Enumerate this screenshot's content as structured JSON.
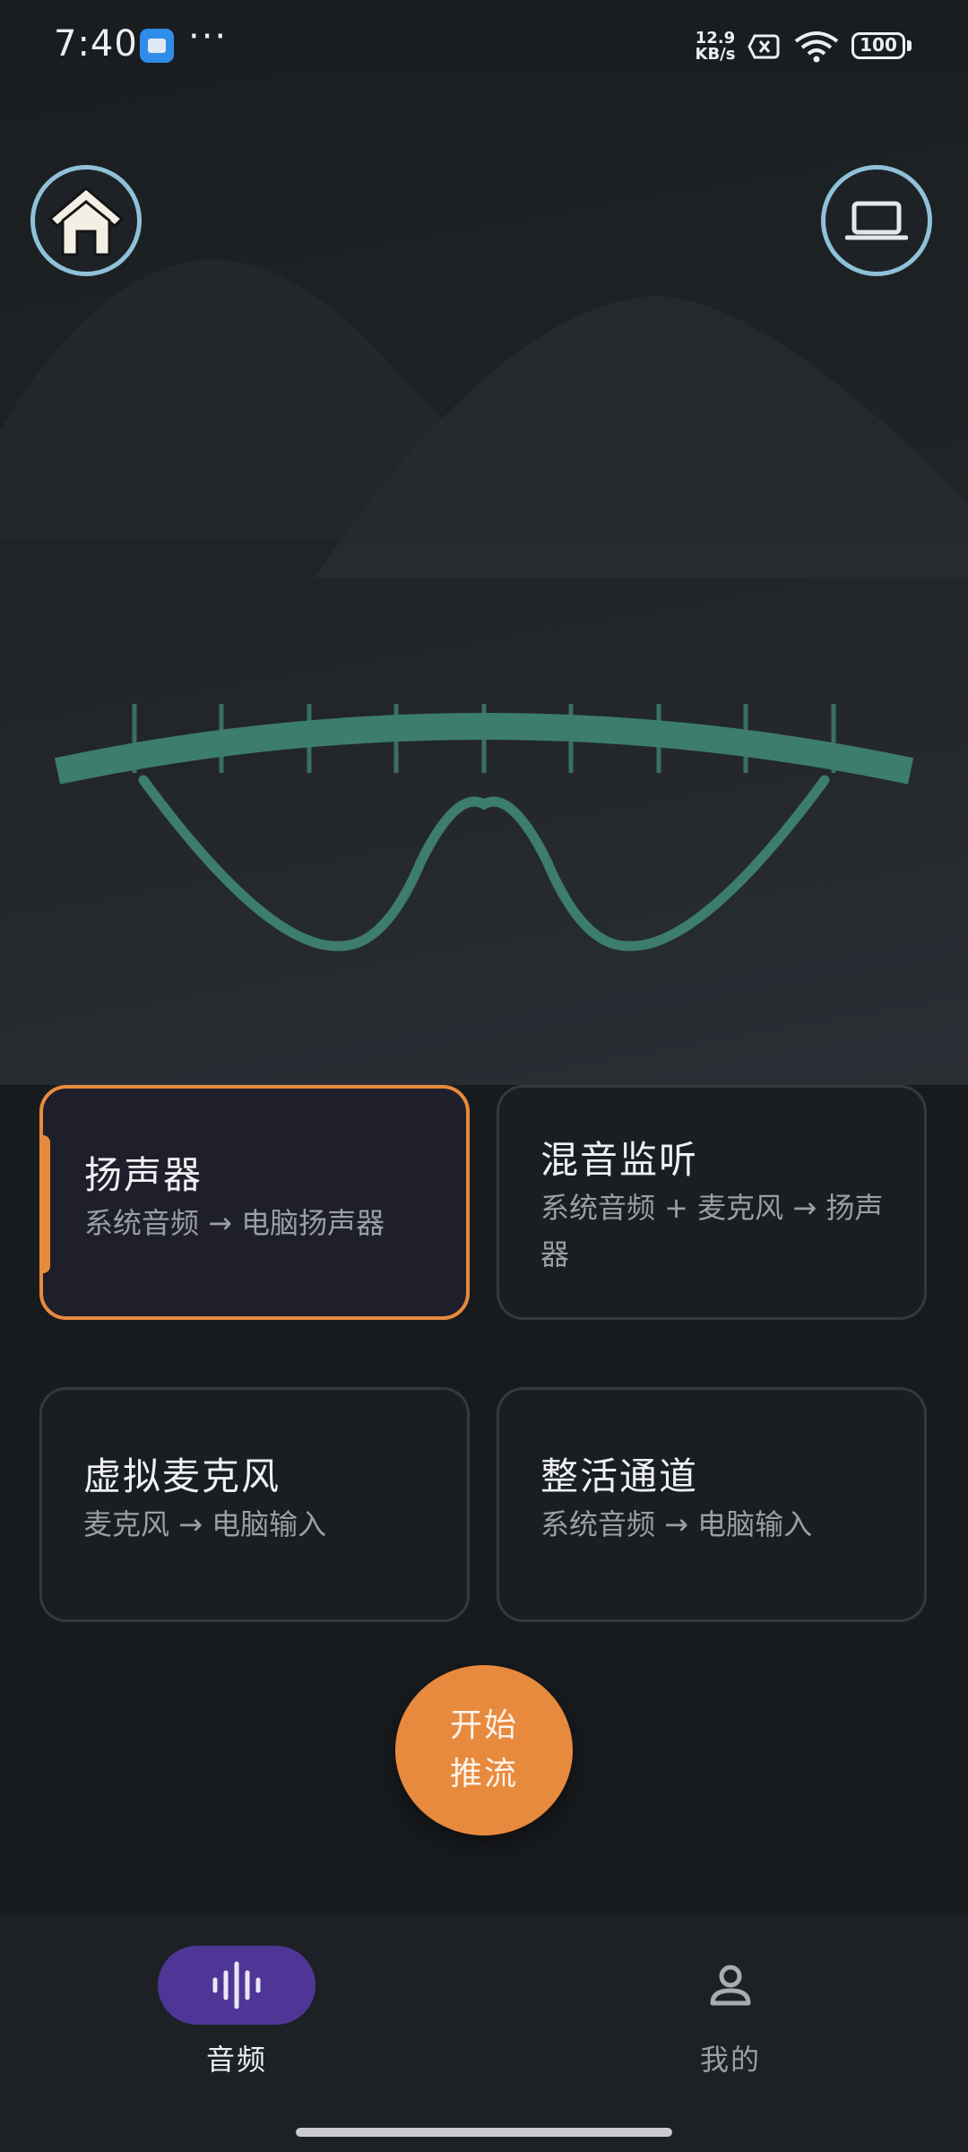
{
  "status_bar": {
    "time": "7:40",
    "more": "···",
    "net_speed_value": "12.9",
    "net_speed_unit": "KB/s",
    "battery": "100",
    "app_icon": "mail-app-icon",
    "icons": [
      "sim-off-icon",
      "wifi-icon",
      "battery-icon"
    ]
  },
  "header": {
    "home_icon": "home-icon",
    "pc_icon": "laptop-icon"
  },
  "hero": {
    "illustration": "arc-gauge-waveform",
    "accent_color": "#3c7d6b"
  },
  "modes": [
    {
      "title": "扬声器",
      "subtitle": "系统音频 → 电脑扬声器",
      "selected": true
    },
    {
      "title": "混音监听",
      "subtitle": "系统音频 + 麦克风 → 扬声器",
      "selected": false
    },
    {
      "title": "虚拟麦克风",
      "subtitle": "麦克风 → 电脑输入",
      "selected": false
    },
    {
      "title": "整活通道",
      "subtitle": "系统音频 → 电脑输入",
      "selected": false
    }
  ],
  "start_button": {
    "line1": "开始",
    "line2": "推流",
    "color": "#e88a3e"
  },
  "bottom_nav": {
    "items": [
      {
        "label": "音频",
        "icon": "audio-wave-icon",
        "active": true
      },
      {
        "label": "我的",
        "icon": "person-icon",
        "active": false
      }
    ],
    "active_color": "#4f3696"
  }
}
